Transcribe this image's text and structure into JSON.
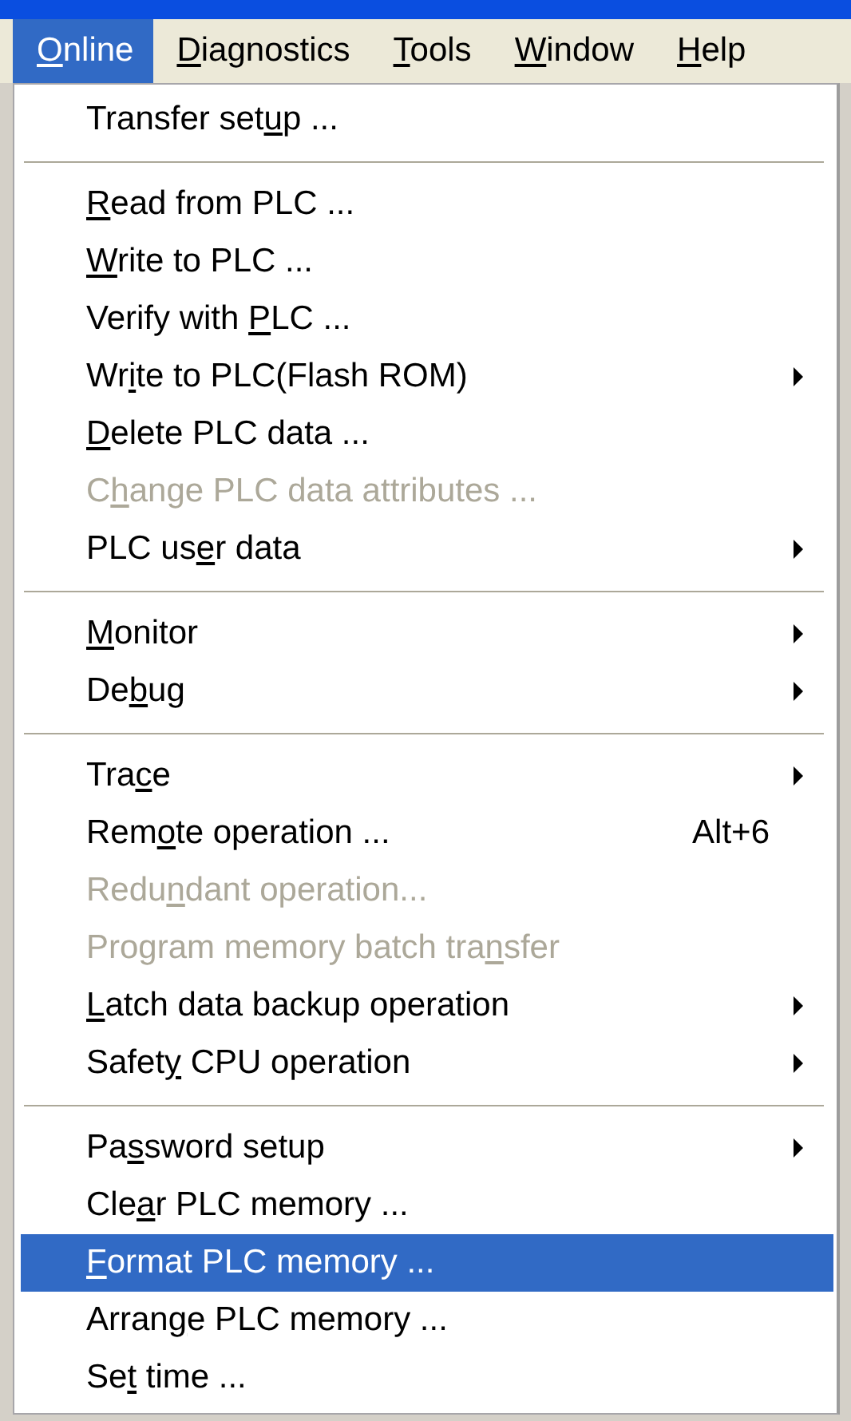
{
  "menubar": [
    {
      "key": "O",
      "post": "nline",
      "selected": true
    },
    {
      "key": "D",
      "post": "iagnostics",
      "selected": false
    },
    {
      "key": "T",
      "post": "ools",
      "selected": false
    },
    {
      "key": "W",
      "post": "indow",
      "selected": false
    },
    {
      "key": "H",
      "post": "elp",
      "selected": false
    }
  ],
  "menu": {
    "groups": [
      [
        {
          "pre": "Transfer set",
          "key": "u",
          "post": "p ...",
          "disabled": false,
          "submenu": false,
          "selected": false
        }
      ],
      [
        {
          "key": "R",
          "post": "ead from PLC ...",
          "disabled": false,
          "submenu": false,
          "selected": false
        },
        {
          "key": "W",
          "post": "rite to PLC ...",
          "disabled": false,
          "submenu": false,
          "selected": false
        },
        {
          "pre": "Verify with ",
          "key": "P",
          "post": "LC ...",
          "disabled": false,
          "submenu": false,
          "selected": false
        },
        {
          "pre": "Wr",
          "key": "i",
          "post": "te to PLC(Flash ROM)",
          "disabled": false,
          "submenu": true,
          "selected": false
        },
        {
          "key": "D",
          "post": "elete PLC data ...",
          "disabled": false,
          "submenu": false,
          "selected": false
        },
        {
          "pre": "C",
          "key": "h",
          "post": "ange PLC data attributes ...",
          "disabled": true,
          "submenu": false,
          "selected": false
        },
        {
          "pre": "PLC us",
          "key": "e",
          "post": "r data",
          "disabled": false,
          "submenu": true,
          "selected": false
        }
      ],
      [
        {
          "key": "M",
          "post": "onitor",
          "disabled": false,
          "submenu": true,
          "selected": false
        },
        {
          "pre": "De",
          "key": "b",
          "post": "ug",
          "disabled": false,
          "submenu": true,
          "selected": false
        }
      ],
      [
        {
          "pre": "Tra",
          "key": "c",
          "post": "e",
          "disabled": false,
          "submenu": true,
          "selected": false
        },
        {
          "pre": "Rem",
          "key": "o",
          "post": "te operation ...",
          "shortcut": "Alt+6",
          "disabled": false,
          "submenu": false,
          "selected": false
        },
        {
          "pre": "Redu",
          "key": "n",
          "post": "dant operation...",
          "disabled": true,
          "submenu": false,
          "selected": false
        },
        {
          "pre": "Program memory batch tra",
          "key": "n",
          "post": "sfer",
          "disabled": true,
          "submenu": false,
          "selected": false
        },
        {
          "key": "L",
          "post": "atch data backup operation",
          "disabled": false,
          "submenu": true,
          "selected": false
        },
        {
          "pre": "Safet",
          "key": "y",
          "post": " CPU operation",
          "disabled": false,
          "submenu": true,
          "selected": false
        }
      ],
      [
        {
          "pre": "Pa",
          "key": "s",
          "post": "sword setup",
          "disabled": false,
          "submenu": true,
          "selected": false
        },
        {
          "pre": "Cle",
          "key": "a",
          "post": "r PLC memory ...",
          "disabled": false,
          "submenu": false,
          "selected": false
        },
        {
          "key": "F",
          "post": "ormat PLC memory ...",
          "disabled": false,
          "submenu": false,
          "selected": true
        },
        {
          "pre": "Arran",
          "key": "g",
          "post": "e PLC memory ...",
          "disabled": false,
          "submenu": false,
          "selected": false
        },
        {
          "pre": "Se",
          "key": "t",
          "post": " time ...",
          "disabled": false,
          "submenu": false,
          "selected": false
        }
      ]
    ]
  }
}
